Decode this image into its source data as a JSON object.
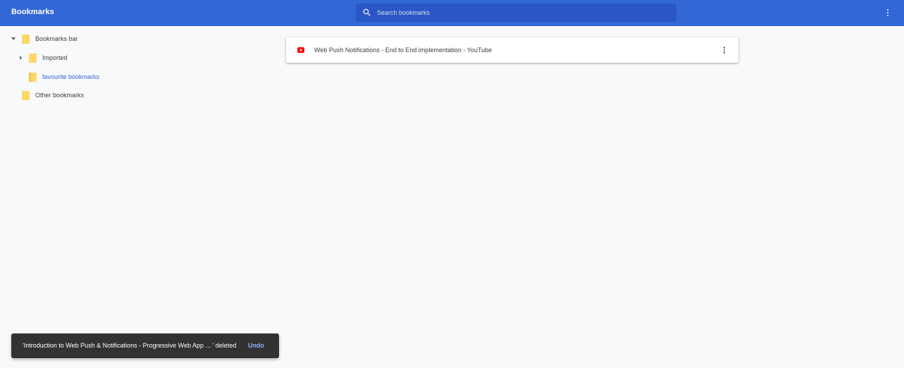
{
  "toolbar": {
    "title": "Bookmarks",
    "search_placeholder": "Search bookmarks",
    "search_value": "",
    "search_icon": "search-icon",
    "menu_icon": "more-vert-icon"
  },
  "sidebar": {
    "items": [
      {
        "label": "Bookmarks bar",
        "expanded": true,
        "icon": "folder-icon"
      },
      {
        "label": "Imported",
        "expanded": false,
        "icon": "folder-icon"
      },
      {
        "label": "favourite bookmarks",
        "selected": true,
        "icon": "folder-open-icon"
      },
      {
        "label": "Other bookmarks",
        "icon": "folder-icon"
      }
    ]
  },
  "main": {
    "bookmarks": [
      {
        "title": "Web Push Notifications - End to End implementation - YouTube",
        "icon": "youtube-icon"
      }
    ]
  },
  "toast": {
    "message": "'Introduction to Web Push & Notifications - Progressive Web App ... ' deleted",
    "action": "Undo"
  },
  "colors": {
    "toolbar": "#3367d6",
    "search_bg": "#2a56c6",
    "background": "#f8f9fa",
    "folder": "#fcd869",
    "selected_text": "#3367d6",
    "toast_bg": "#323232",
    "toast_action": "#8ab4f8"
  }
}
